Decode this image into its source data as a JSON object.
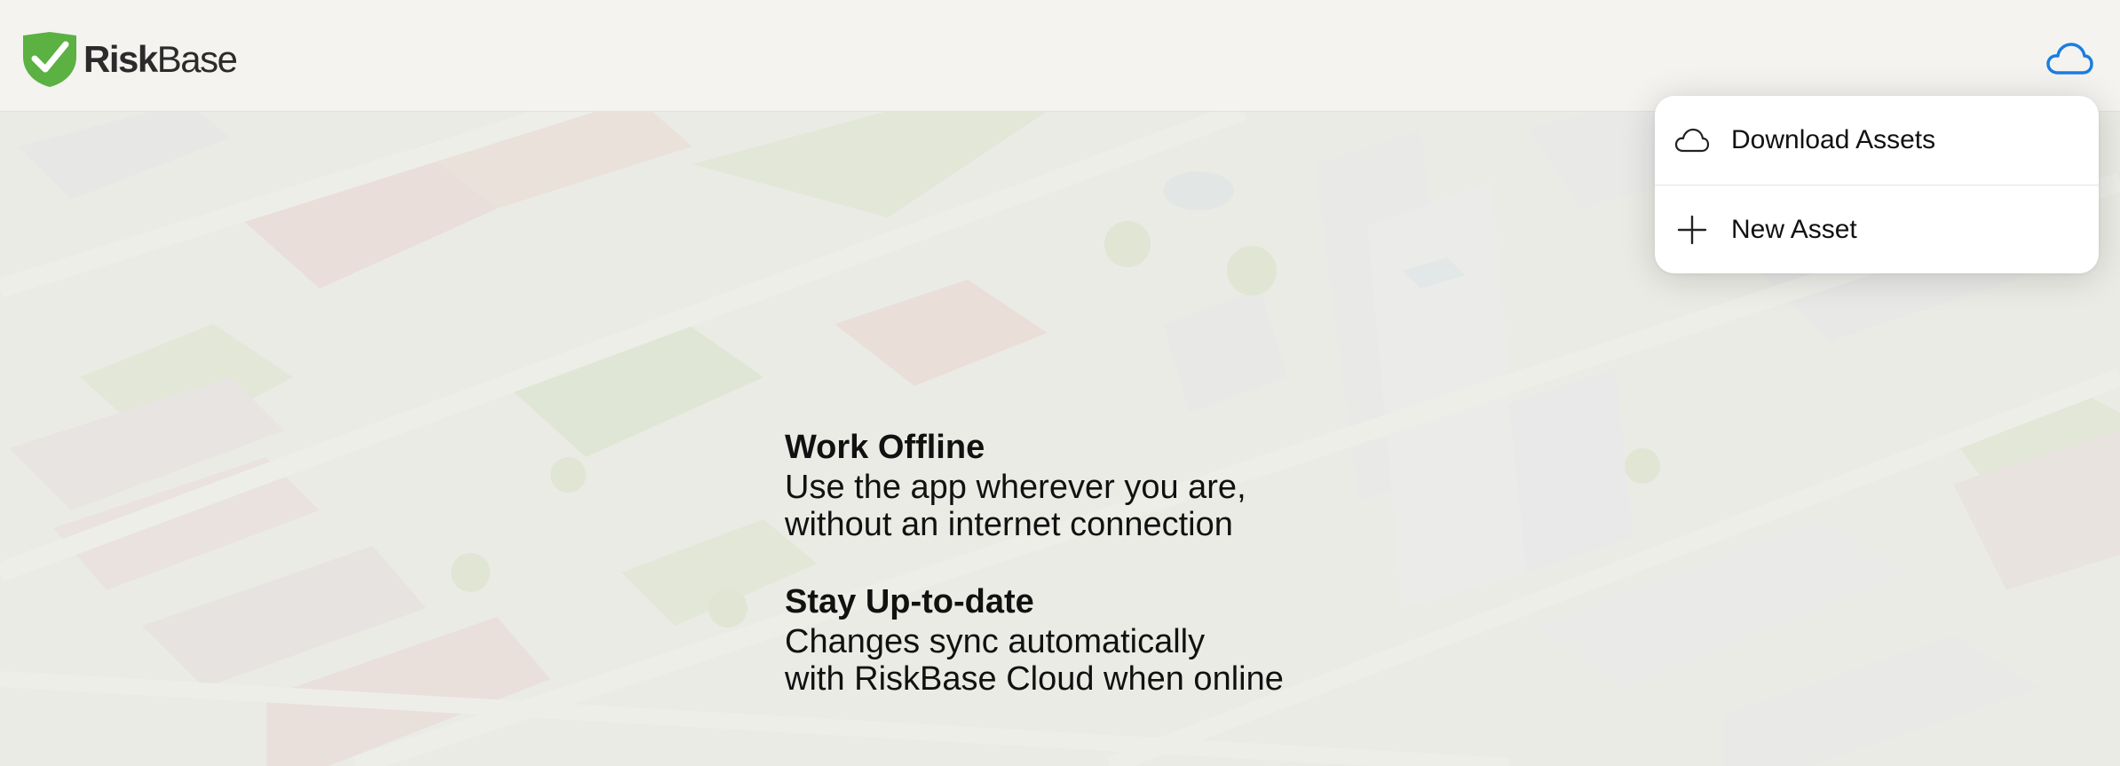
{
  "header": {
    "logo_risk": "Risk",
    "logo_base": "Base",
    "cloud_icon": "cloud-icon",
    "accent_color": "#1a7ee0"
  },
  "menu": {
    "items": [
      {
        "label": "Download Assets",
        "icon": "cloud-icon"
      },
      {
        "label": "New Asset",
        "icon": "plus-icon"
      }
    ]
  },
  "features": [
    {
      "title": "Work Offline",
      "lines": [
        "Use the app wherever you are,",
        "without an internet connection"
      ]
    },
    {
      "title": "Stay Up-to-date",
      "lines": [
        "Changes sync automatically",
        "with RiskBase Cloud when online"
      ]
    }
  ],
  "colors": {
    "logo_green": "#5bb141",
    "header_bg": "#f4f3f0"
  }
}
